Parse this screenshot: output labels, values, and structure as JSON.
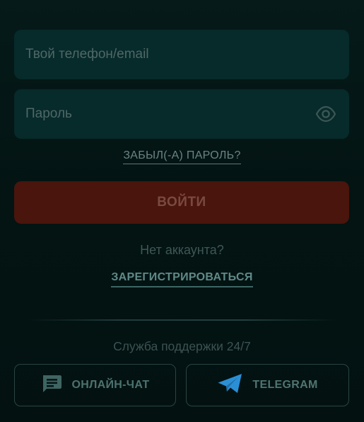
{
  "login_field": {
    "placeholder": "Твой телефон/email",
    "value": ""
  },
  "password_field": {
    "placeholder": "Пароль",
    "value": ""
  },
  "forgot_link": "ЗАБЫЛ(-А) ПАРОЛЬ?",
  "login_button": "ВОЙТИ",
  "no_account_text": "Нет аккаунта?",
  "register_link": "ЗАРЕГИСТРИРОВАТЬСЯ",
  "support_text": "Служба поддержки 24/7",
  "online_chat_button": {
    "label": "ОНЛАЙН-ЧАТ",
    "icon": "chat-icon"
  },
  "telegram_button": {
    "label": "TELEGRAM",
    "icon": "telegram-icon"
  },
  "colors": {
    "background": "#041716",
    "field": "#072a2a",
    "login_button": "#4a150c",
    "telegram_blue": "#2b8fd6"
  }
}
